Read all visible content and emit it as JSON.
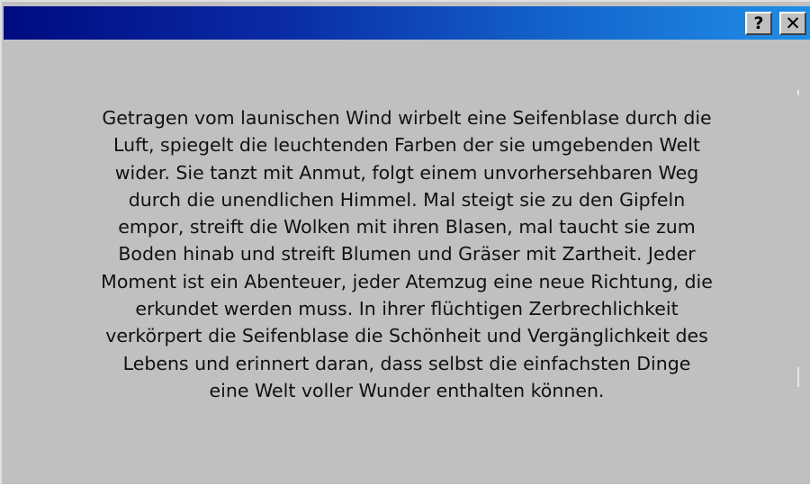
{
  "window": {
    "help_button": "?",
    "close_button": "✕"
  },
  "dialog": {
    "message": "Getragen vom launischen Wind wirbelt eine Seifenblase durch die Luft, spiegelt die leuchtenden Farben der sie umgebenden Welt wider. Sie tanzt mit Anmut, folgt einem unvorhersehbaren Weg durch die unendlichen Himmel. Mal steigt sie zu den Gipfeln empor, streift die Wolken mit ihren Blasen, mal taucht sie zum Boden hinab und streift Blumen und Gräser mit Zartheit. Jeder Moment ist ein Abenteuer, jeder Atemzug eine neue Richtung, die erkundet werden muss. In ihrer flüchtigen Zerbrechlichkeit verkörpert die Seifenblase die Schönheit und Vergänglichkeit des Lebens und erinnert daran, dass selbst die einfachsten Dinge eine Welt voller Wunder enthalten können."
  },
  "colors": {
    "titlebar_start": "#000b80",
    "titlebar_end": "#1f8ee8",
    "window_background": "#c0c0c0"
  }
}
